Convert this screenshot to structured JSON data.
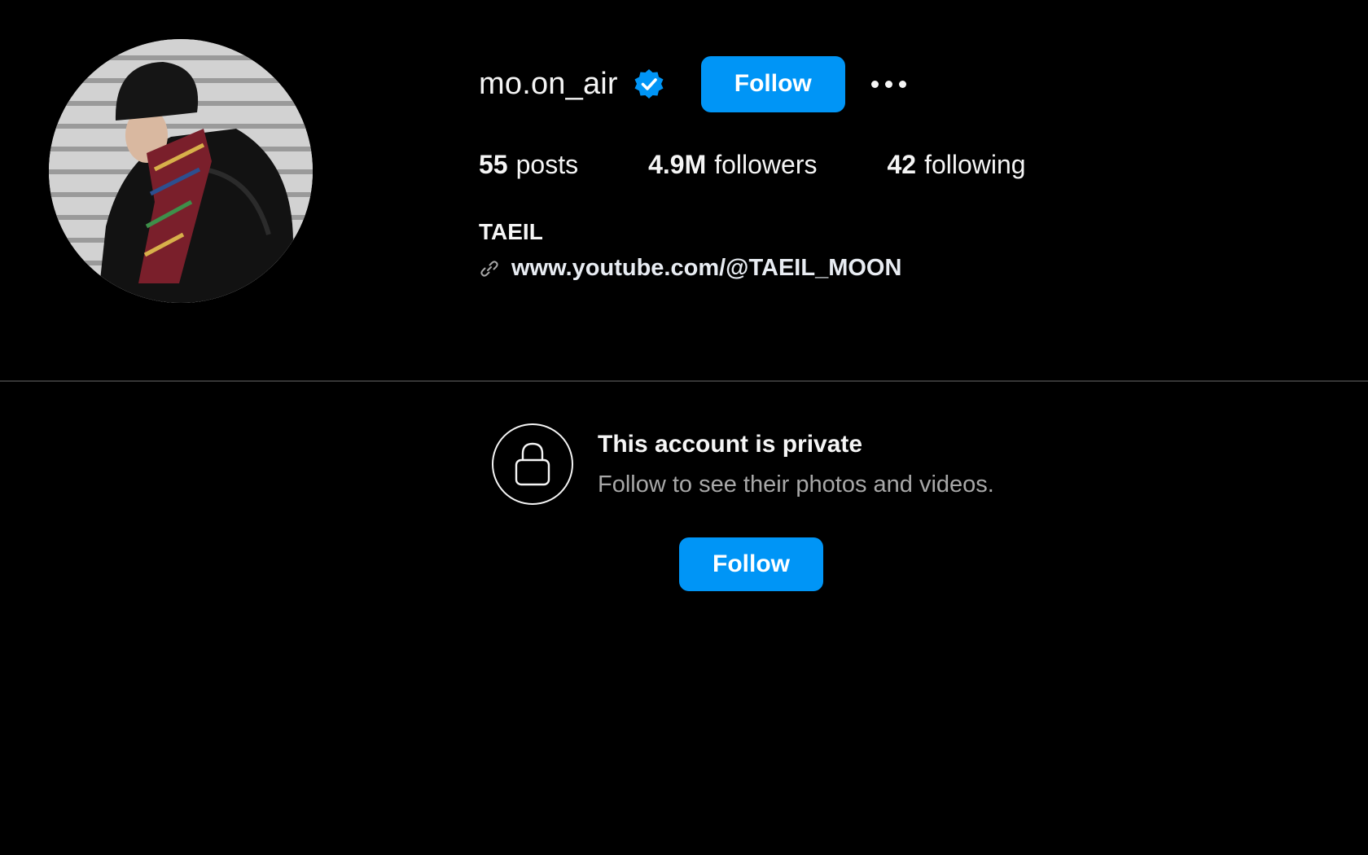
{
  "profile": {
    "username": "mo.on_air",
    "verified_icon": "verified-badge-icon",
    "follow_label": "Follow",
    "more_icon": "more-options-icon",
    "stats": {
      "posts_count": "55",
      "posts_label": "posts",
      "followers_count": "4.9M",
      "followers_label": "followers",
      "following_count": "42",
      "following_label": "following"
    },
    "full_name": "TAEIL",
    "link_icon": "link-icon",
    "link": "www.youtube.com/@TAEIL_MOON"
  },
  "private_notice": {
    "icon": "lock-icon",
    "title": "This account is private",
    "subtitle": "Follow to see their photos and videos.",
    "follow_label": "Follow"
  },
  "colors": {
    "background": "#000000",
    "accent": "#0095f6",
    "divider": "#363636",
    "secondary_text": "#a8a8a8"
  }
}
